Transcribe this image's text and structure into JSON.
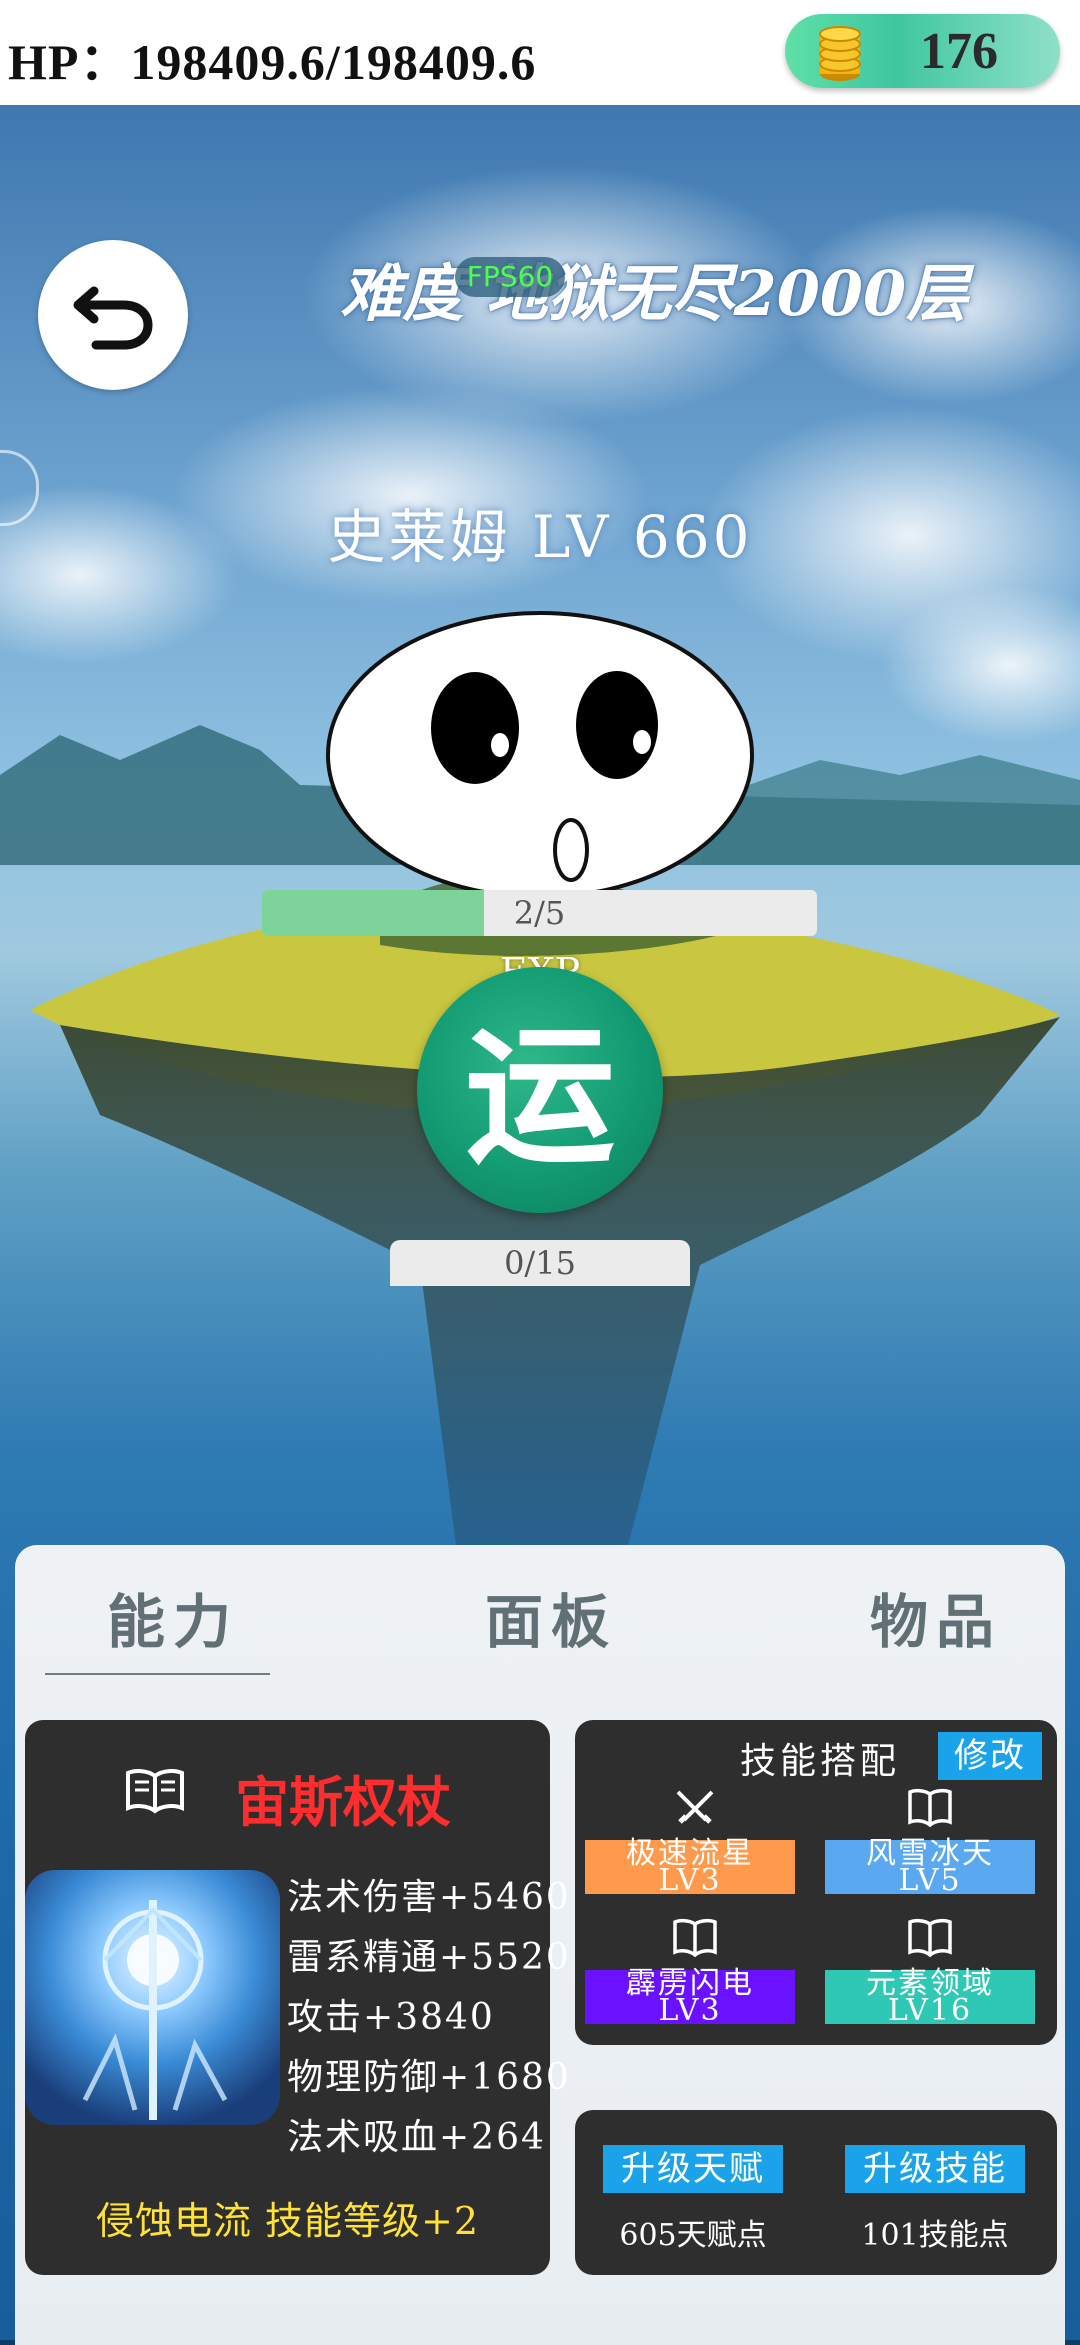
{
  "status_bar": {
    "hp_text": "HP：198409.6/198409.6",
    "coins": "176",
    "coin_icon": "gold-coins-icon"
  },
  "scene": {
    "difficulty": "难度 地狱无尽2000层",
    "fps": "FPS60",
    "monster_name": "史莱姆 LV 660",
    "exp_label": "EXP",
    "exp_text": "2/5",
    "exp_fraction": 0.4,
    "cultivate_label": "运",
    "cultivate_progress_text": "0/15",
    "cultivate_fraction": 0.0
  },
  "tabs": [
    "能力",
    "面板",
    "物品"
  ],
  "weapon": {
    "name": "宙斯权杖",
    "stats": [
      "法术伤害+5460",
      "雷系精通+5520",
      "攻击+3840",
      "物理防御+1680",
      "法术吸血+264"
    ],
    "effect": "侵蚀电流 技能等级+2"
  },
  "skills": {
    "title": "技能搭配",
    "edit_label": "修改",
    "items": [
      {
        "name": "极速流星",
        "level": "LV3",
        "color": "#ff9a4d",
        "icon": "crossed-swords-icon"
      },
      {
        "name": "风雪冰天",
        "level": "LV5",
        "color": "#5aa8f0",
        "icon": "book-icon"
      },
      {
        "name": "霹雳闪电",
        "level": "LV3",
        "color": "#6a12ff",
        "icon": "book-icon"
      },
      {
        "name": "元素领域",
        "level": "LV16",
        "color": "#2ec8b4",
        "icon": "book-icon"
      }
    ]
  },
  "upgrade": {
    "talent_label": "升级天赋",
    "talent_points": "605天赋点",
    "skill_label": "升级技能",
    "skill_points": "101技能点"
  },
  "colors": {
    "accent_blue": "#1aa3e8",
    "exp_fill": "#7dd39a",
    "cultivate_green": "#129a72",
    "weapon_name_red": "#ff2d2d",
    "effect_yellow": "#ffe13a"
  }
}
